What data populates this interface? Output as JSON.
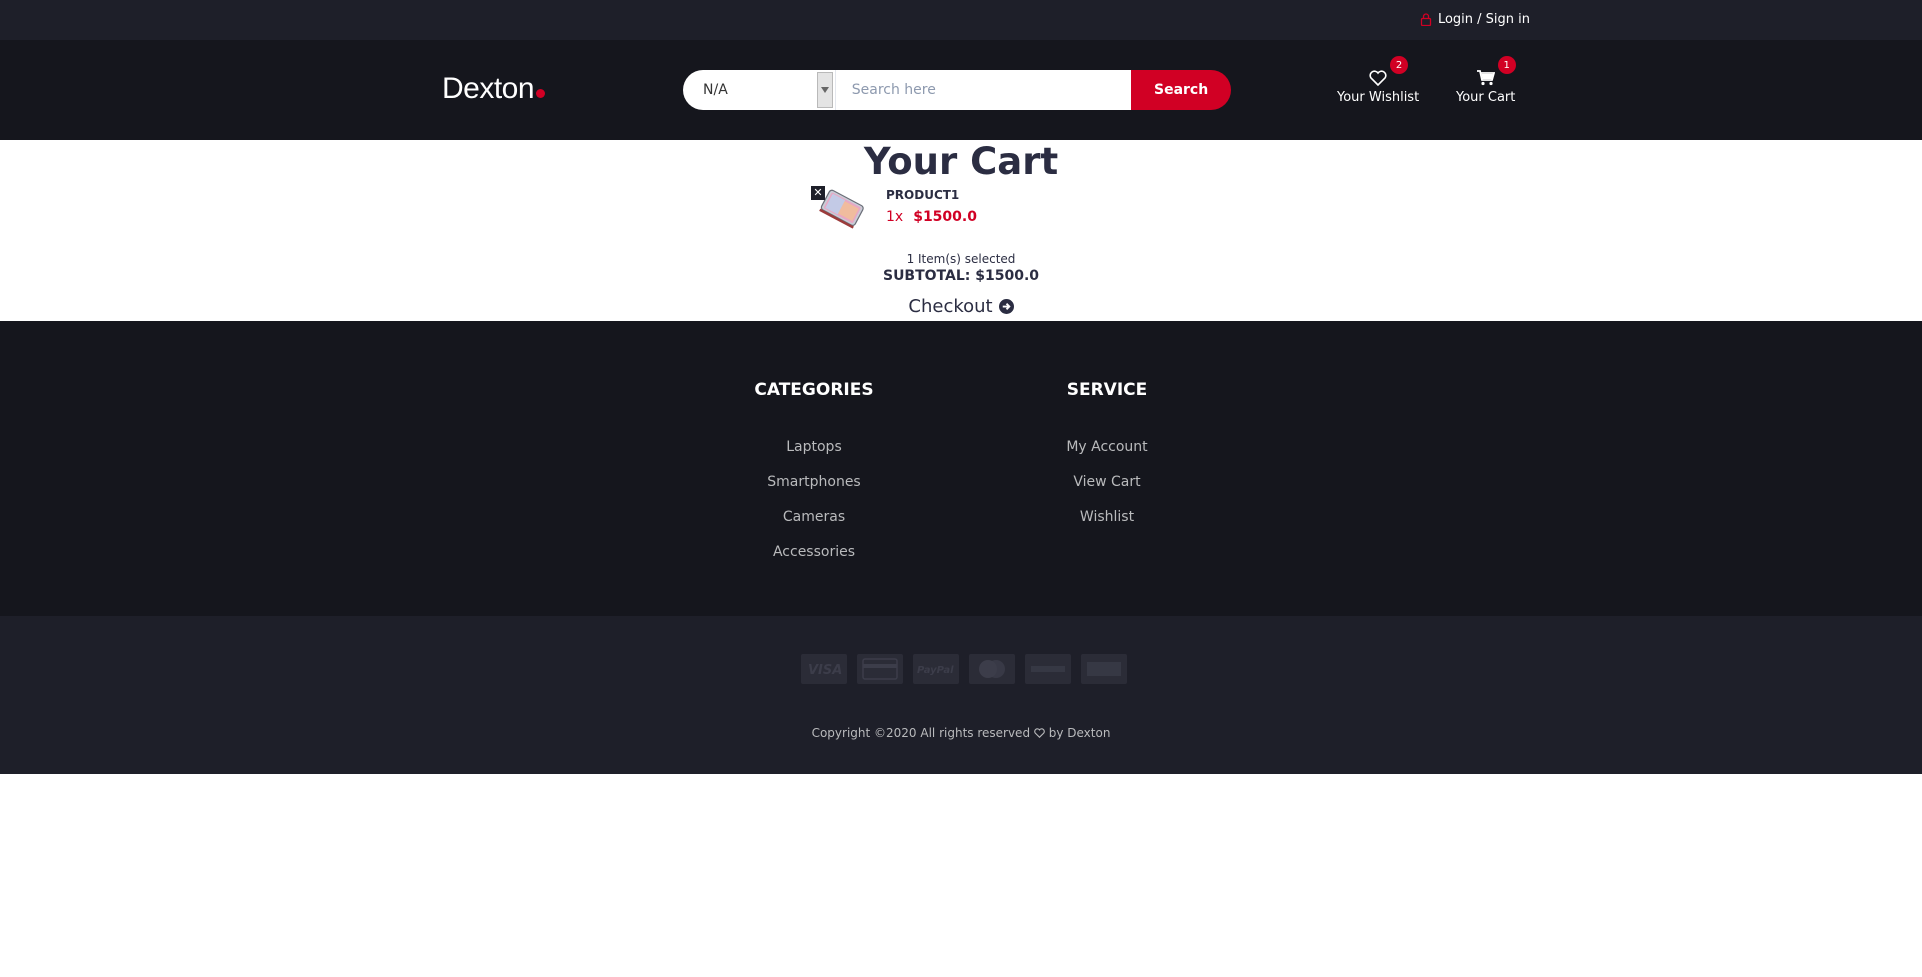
{
  "top_bar": {
    "login_label": "Login / Sign in"
  },
  "header": {
    "logo_text": "Dexton",
    "search": {
      "category_value": "N/A",
      "placeholder": "Search here",
      "button_label": "Search"
    },
    "wishlist": {
      "label": "Your Wishlist",
      "count": "2"
    },
    "cart": {
      "label": "Your Cart",
      "count": "1"
    }
  },
  "main": {
    "title": "Your Cart",
    "items": [
      {
        "name": "PRODUCT1",
        "qty": "1x",
        "price": "$1500.0"
      }
    ],
    "summary": {
      "items_selected": "1 Item(s) selected",
      "subtotal": "SUBTOTAL: $1500.0"
    },
    "checkout_label": "Checkout"
  },
  "footer": {
    "categories_title": "CATEGORIES",
    "categories": [
      "Laptops",
      "Smartphones",
      "Cameras",
      "Accessories"
    ],
    "service_title": "SERVICE",
    "service": [
      "My Account",
      "View Cart",
      "Wishlist"
    ]
  },
  "bottom_footer": {
    "payment_icons": [
      "visa-icon",
      "credit-card-icon",
      "paypal-icon",
      "mastercard-icon",
      "discover-icon",
      "amex-icon"
    ],
    "copyright_prefix": "Copyright ©2020 All rights reserved",
    "copyright_suffix": "by Dexton"
  },
  "colors": {
    "accent": "#d10024",
    "header_bg": "#15161d",
    "top_bar_bg": "#1e1f29",
    "text_dark": "#2b2d42"
  }
}
